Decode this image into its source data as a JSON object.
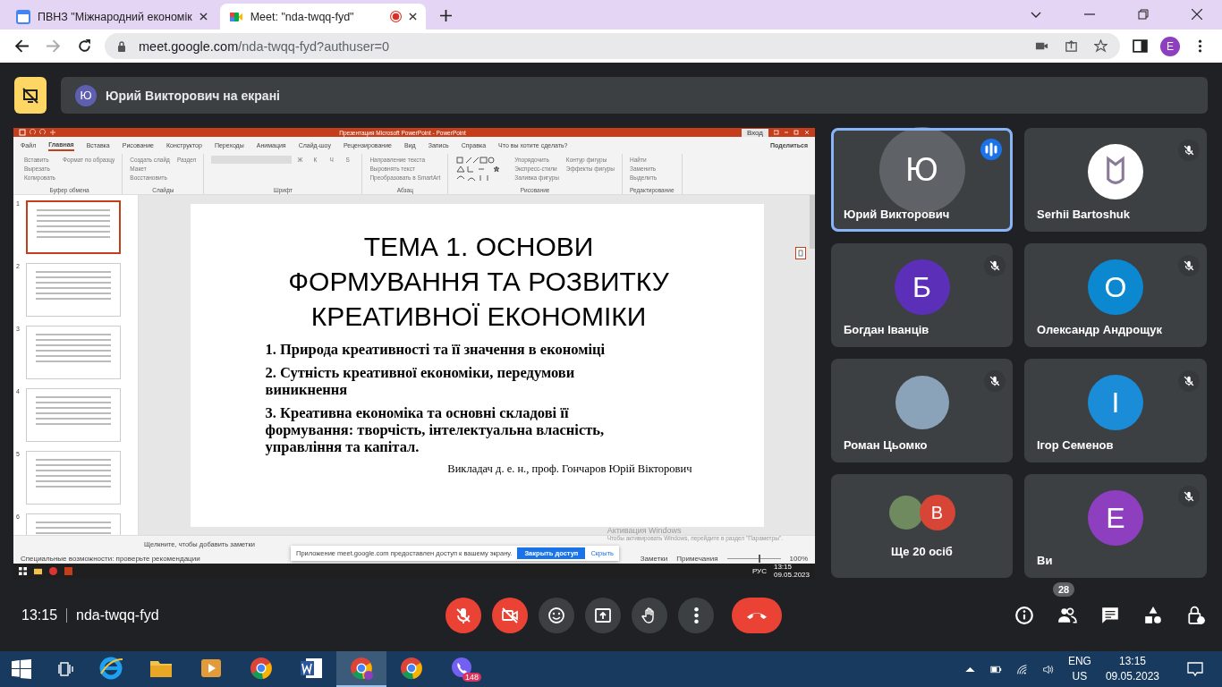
{
  "browser": {
    "tabs": [
      {
        "title": "ПВНЗ \"Міжнародний економік",
        "selected": false
      },
      {
        "title": "Meet: \"nda-twqq-fyd\"",
        "selected": true,
        "recording": true
      }
    ],
    "url_host": "meet.google.com",
    "url_path": "/nda-twqq-fyd?authuser=0",
    "profile_initial": "E"
  },
  "presenting_banner": {
    "initial": "Ю",
    "text": "Юрий Викторович на екрані"
  },
  "shared_screen": {
    "window_title": "Презентация Microsoft PowerPoint  -  PowerPoint",
    "sign_in": "Вход",
    "ribbon_tabs": [
      {
        "label": "Файл",
        "selected": false
      },
      {
        "label": "Главная",
        "selected": true
      },
      {
        "label": "Вставка",
        "selected": false
      },
      {
        "label": "Рисование",
        "selected": false
      },
      {
        "label": "Конструктор",
        "selected": false
      },
      {
        "label": "Переходы",
        "selected": false
      },
      {
        "label": "Анимация",
        "selected": false
      },
      {
        "label": "Слайд-шоу",
        "selected": false
      },
      {
        "label": "Рецензирование",
        "selected": false
      },
      {
        "label": "Вид",
        "selected": false
      },
      {
        "label": "Запись",
        "selected": false
      },
      {
        "label": "Справка",
        "selected": false
      }
    ],
    "search_hint": "Что вы хотите сделать?",
    "share": "Поделиться",
    "ribbon_groups": [
      {
        "label": "Буфер обмена",
        "kind": "plain",
        "buttons": [
          "Вставить",
          "Вырезать",
          "Копировать",
          "Формат по образцу"
        ]
      },
      {
        "label": "Слайды",
        "kind": "plain",
        "buttons": [
          "Создать слайд",
          "Макет",
          "Восстановить",
          "Раздел"
        ]
      },
      {
        "label": "Шрифт",
        "kind": "font",
        "buttons": [
          "Ж",
          "К",
          "Ч",
          "S"
        ]
      },
      {
        "label": "Абзац",
        "kind": "plain",
        "buttons": [
          "Направление текста",
          "Выровнять текст",
          "Преобразовать в SmartArt"
        ]
      },
      {
        "label": "Рисование",
        "kind": "shapes",
        "buttons": [
          "Упорядочить",
          "Экспресс-стили",
          "Заливка фигуры",
          "Контур фигуры",
          "Эффекты фигуры"
        ]
      },
      {
        "label": "Редактирование",
        "kind": "plain",
        "buttons": [
          "Найти",
          "Заменить",
          "Выделить"
        ]
      }
    ],
    "thumbnails": [
      {
        "number": "1",
        "selected": true
      },
      {
        "number": "2",
        "selected": false
      },
      {
        "number": "3",
        "selected": false
      },
      {
        "number": "4",
        "selected": false
      },
      {
        "number": "5",
        "selected": false
      },
      {
        "number": "6",
        "selected": false
      }
    ],
    "slide": {
      "title": "ТЕМА 1. ОСНОВИ ФОРМУВАННЯ ТА РОЗВИТКУ КРЕАТИВНОЇ ЕКОНОМІКИ",
      "points": [
        "1. Природа креативності та її значення в економіці",
        "2. Сутність креативної економіки, передумови виникнення",
        "3. Креативна економіка та основні складові її формування: творчість, інтелектуальна власність, управління та капітал."
      ],
      "lecturer": "Викладач  д. е. н., проф. Гончаров Юрій Вікторович"
    },
    "notes_placeholder": "Щелкните, чтобы добавить заметки",
    "status_left": "Специальные возможности: проверьте рекомендации",
    "status_right": [
      "Заметки",
      "Примечания"
    ],
    "zoom": "100%",
    "zoom_slider": {
      "level": 0.6
    },
    "activation": {
      "title": "Активация Windows",
      "text": "Чтобы активировать Windows, перейдите в раздел \"Параметры\"."
    },
    "share_notice": {
      "text": "Приложение meet.google.com предоставлен доступ к вашему экрану.",
      "stop_button": "Закрыть доступ",
      "hide_link": "Скрыть"
    },
    "inner_tray": {
      "lang": "РУС",
      "time": "13:15",
      "date": "09.05.2023"
    }
  },
  "participants": [
    {
      "name": "Юрий Викторович",
      "kind": "letter",
      "initial": "Ю",
      "color": "#5f6368",
      "muted": false,
      "speaking": true
    },
    {
      "name": "Serhii Bartoshuk",
      "kind": "emblem",
      "muted": true,
      "speaking": false
    },
    {
      "name": "Богдан Іванців",
      "kind": "letter",
      "initial": "Б",
      "color": "#5b2fb8",
      "muted": true,
      "speaking": false
    },
    {
      "name": "Олександр Андрощук",
      "kind": "letter",
      "initial": "О",
      "color": "#0b88d0",
      "muted": true,
      "speaking": false
    },
    {
      "name": "Роман Цьомко",
      "kind": "photo",
      "muted": true,
      "speaking": false
    },
    {
      "name": "Ігор Семенов",
      "kind": "letter",
      "initial": "І",
      "color": "#1a8cd8",
      "muted": true,
      "speaking": false
    },
    {
      "name": "Ще 20 осіб",
      "kind": "more",
      "initial": "В",
      "color": "#d64535",
      "muted": false,
      "speaking": false
    },
    {
      "name": "Ви",
      "kind": "letter",
      "initial": "Е",
      "color": "#8e3fc0",
      "muted": true,
      "speaking": false
    }
  ],
  "meeting": {
    "time": "13:15",
    "code": "nda-twqq-fyd",
    "people_count": "28"
  },
  "controls": [
    {
      "kind": "mic",
      "on": false
    },
    {
      "kind": "camera",
      "on": false
    },
    {
      "kind": "emoji",
      "on": true
    },
    {
      "kind": "present",
      "on": true
    },
    {
      "kind": "hand",
      "on": true
    },
    {
      "kind": "more",
      "on": true
    },
    {
      "kind": "end"
    }
  ],
  "taskbar": {
    "apps": [
      {
        "kind": "ie",
        "selected": false
      },
      {
        "kind": "explorer",
        "selected": false
      },
      {
        "kind": "media",
        "selected": false
      },
      {
        "kind": "chrome",
        "selected": false
      },
      {
        "kind": "word",
        "selected": false
      },
      {
        "kind": "chrome-profile",
        "selected": true
      },
      {
        "kind": "chrome",
        "selected": false
      },
      {
        "kind": "viber",
        "selected": false,
        "badge": "148"
      }
    ],
    "lang": "ENG",
    "region": "US",
    "time": "13:15",
    "date": "09.05.2023"
  }
}
